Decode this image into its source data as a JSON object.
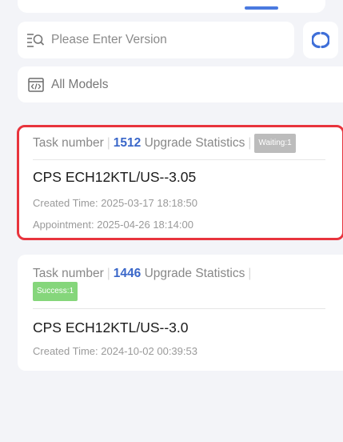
{
  "search": {
    "placeholder": "Please Enter Version"
  },
  "model_filter": {
    "label": "All Models"
  },
  "tasks": [
    {
      "task_label": "Task number",
      "task_number": "1512",
      "stats_label": "Upgrade Statistics",
      "status_badge": "Waiting:1",
      "model": "CPS ECH12KTL/US--3.05",
      "created_time": "Created Time:  2025-03-17 18:18:50",
      "appointment": "Appointment: 2025-04-26 18:14:00"
    },
    {
      "task_label": "Task number",
      "task_number": "1446",
      "stats_label": "Upgrade Statistics",
      "status_badge": "Success:1",
      "model": "CPS ECH12KTL/US--3.0",
      "created_time": "Created Time:  2024-10-02 00:39:53"
    }
  ],
  "colors": {
    "accent": "#3a67c9",
    "highlight": "#e8343d",
    "waiting": "#bcbcbc",
    "success": "#85d67b"
  }
}
